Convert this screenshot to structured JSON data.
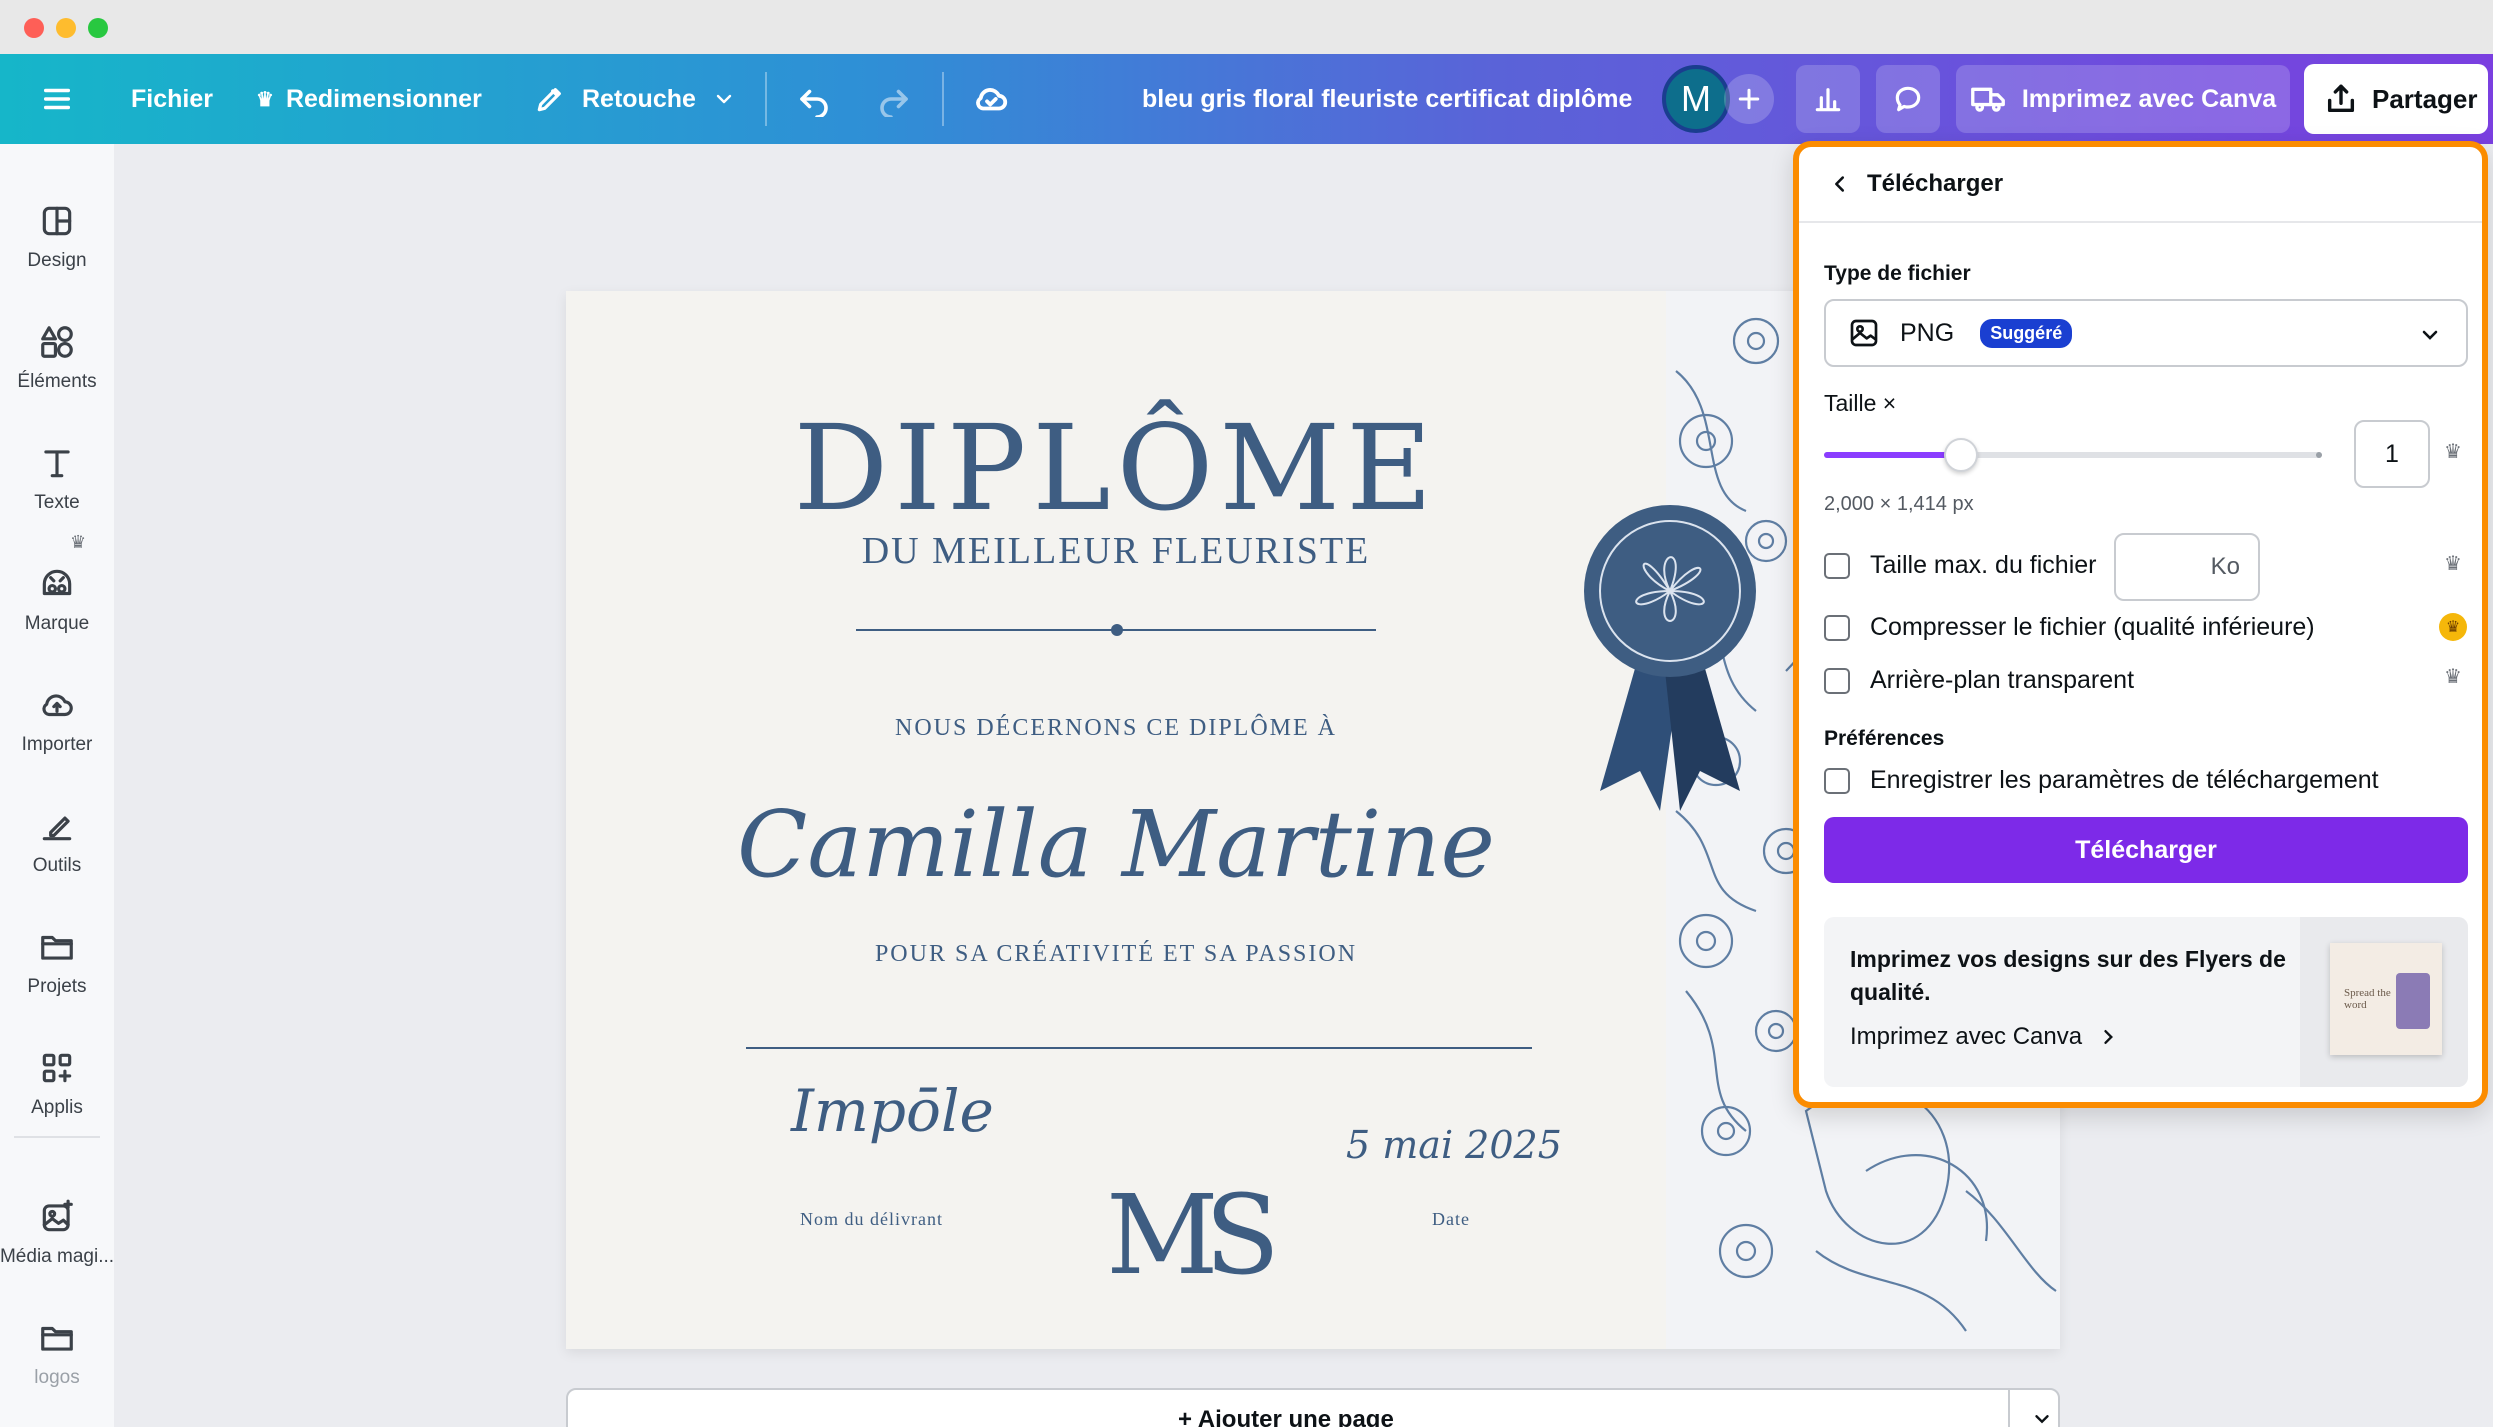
{
  "topbar": {
    "file": "Fichier",
    "resize": "Redimensionner",
    "edit": "Retouche",
    "doc_title": "bleu gris floral fleuriste certificat diplôme",
    "avatar_initial": "M",
    "print": "Imprimez avec Canva",
    "share": "Partager"
  },
  "sidebar": {
    "items": [
      {
        "label": "Design"
      },
      {
        "label": "Éléments"
      },
      {
        "label": "Texte"
      },
      {
        "label": "Marque"
      },
      {
        "label": "Importer"
      },
      {
        "label": "Outils"
      },
      {
        "label": "Projets"
      },
      {
        "label": "Applis"
      },
      {
        "label": "Média magi..."
      },
      {
        "label": "logos"
      }
    ]
  },
  "diploma": {
    "title": "DIPLÔME",
    "subtitle": "DU MEILLEUR FLEURISTE",
    "award_line": "NOUS DÉCERNONS CE DIPLÔME À",
    "recipient": "Camilla Martine",
    "reason": "POUR SA CRÉATIVITÉ ET SA PASSION",
    "signature": "Impōle",
    "date": "5 mai 2025",
    "issuer_label": "Nom du délivrant",
    "date_label": "Date",
    "monogram": "MS"
  },
  "add_page": "+ Ajouter une page",
  "download_panel": {
    "title": "Télécharger",
    "file_type_label": "Type de fichier",
    "file_type": "PNG",
    "suggested_badge": "Suggéré",
    "size_label": "Taille ×",
    "size_multiplier": 1,
    "size_value": "1",
    "dimensions": "2,000 × 1,414 px",
    "max_size_label": "Taille max. du fichier",
    "max_size_unit": "Ko",
    "compress_label": "Compresser le fichier (qualité inférieure)",
    "transparent_label": "Arrière-plan transparent",
    "preferences_label": "Préférences",
    "save_settings_label": "Enregistrer les paramètres de téléchargement",
    "download_button": "Télécharger",
    "promo_title": "Imprimez vos designs sur des Flyers de qualité.",
    "promo_link": "Imprimez avec Canva",
    "promo_card_text": "Spread the word"
  },
  "colors": {
    "accent_purple": "#7d2ae8",
    "panel_border": "#fb8c00",
    "diploma_blue": "#3e5d82",
    "badge_blue": "#1a3fd1"
  }
}
